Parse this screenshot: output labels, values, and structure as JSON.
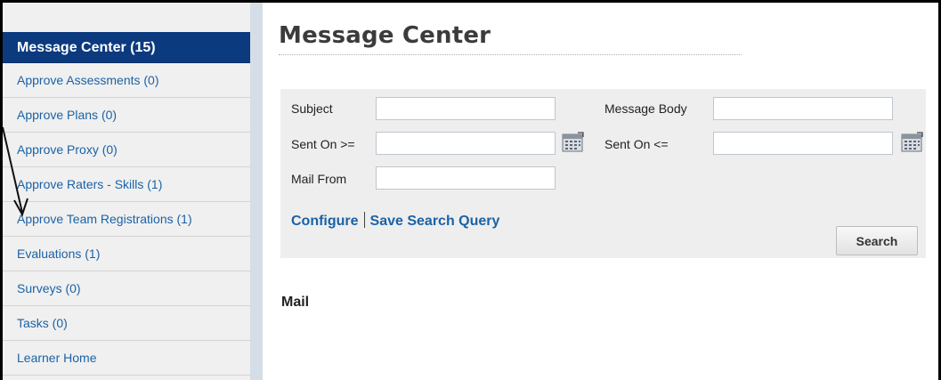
{
  "sidebar": {
    "header": "Message Center (15)",
    "items": [
      {
        "label": "Approve Assessments (0)"
      },
      {
        "label": "Approve Plans (0)"
      },
      {
        "label": "Approve Proxy (0)"
      },
      {
        "label": "Approve Raters - Skills (1)"
      },
      {
        "label": "Approve Team Registrations (1)"
      },
      {
        "label": "Evaluations (1)"
      },
      {
        "label": "Surveys (0)"
      },
      {
        "label": "Tasks (0)"
      },
      {
        "label": "Learner Home"
      }
    ]
  },
  "main": {
    "title": "Message Center",
    "search": {
      "subject_label": "Subject",
      "subject_value": "",
      "message_body_label": "Message Body",
      "message_body_value": "",
      "sent_on_from_label": "Sent On >=",
      "sent_on_from_value": "",
      "sent_on_to_label": "Sent On <=",
      "sent_on_to_value": "",
      "mail_from_label": "Mail From",
      "mail_from_value": "",
      "configure_link": "Configure",
      "save_query_link": "Save Search Query",
      "search_button": "Search"
    },
    "mail_heading": "Mail"
  },
  "icons": {
    "calendar": "calendar-icon"
  },
  "colors": {
    "sidebar_header_bg": "#0b3a7e",
    "link": "#1a62a6",
    "sidebar_bg": "#f0f0f0",
    "panel_bg": "#eeeeee"
  }
}
